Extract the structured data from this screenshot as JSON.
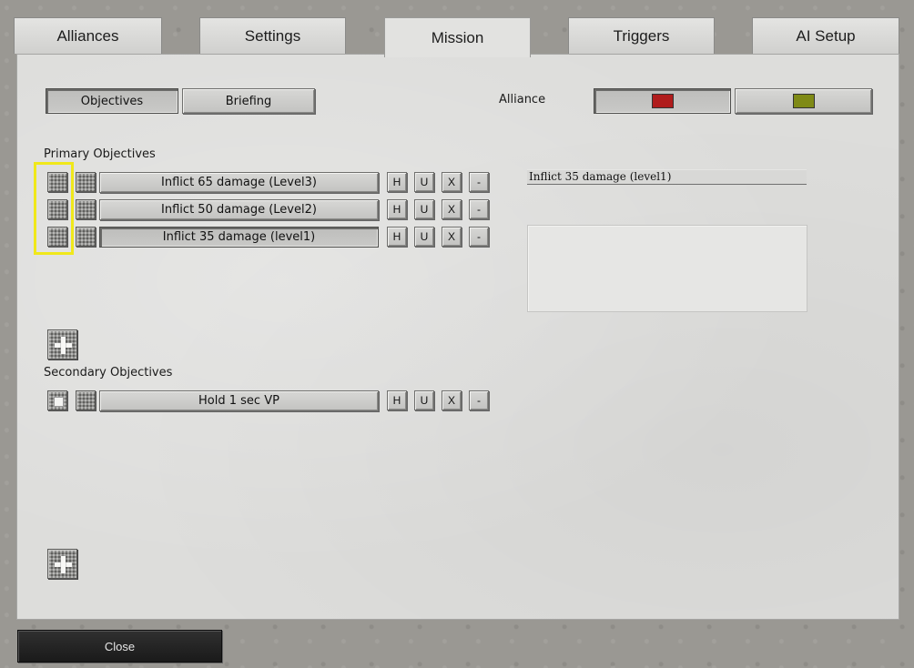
{
  "tabs": [
    {
      "label": "Alliances"
    },
    {
      "label": "Settings"
    },
    {
      "label": "Mission",
      "active": true
    },
    {
      "label": "Triggers"
    },
    {
      "label": "AI Setup"
    }
  ],
  "subtabs": {
    "objectives": "Objectives",
    "briefing": "Briefing",
    "active": "Objectives"
  },
  "alliance": {
    "label": "Alliance",
    "swatches": [
      {
        "color": "#b01c1c",
        "selected": true
      },
      {
        "color": "#7f8a16",
        "selected": false
      }
    ]
  },
  "primary": {
    "label": "Primary Objectives",
    "items": [
      {
        "text": "Inflict 65 damage (Level3)",
        "checked": false
      },
      {
        "text": "Inflict 50 damage (Level2)",
        "checked": false
      },
      {
        "text": "Inflict 35 damage (level1)",
        "checked": false,
        "selected": true
      }
    ]
  },
  "secondary": {
    "label": "Secondary Objectives",
    "items": [
      {
        "text": "Hold 1 sec VP",
        "checked": true
      }
    ]
  },
  "row_buttons": {
    "h": "H",
    "u": "U",
    "x": "X",
    "minus": "-"
  },
  "detail": {
    "title": "Inflict 35 damage (level1)",
    "description": ""
  },
  "close_label": "Close"
}
